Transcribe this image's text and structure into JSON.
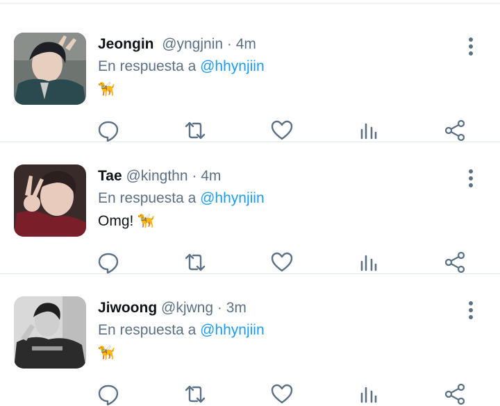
{
  "theme": {
    "text": "#0f1419",
    "secondary": "#5b7083",
    "link": "#1d9bf0",
    "divider": "#e1e8ed"
  },
  "tweets": [
    {
      "name": "Jeongin",
      "handle": "@yngjnin",
      "separator": "·",
      "time": "4m",
      "reply_prefix": "En respuesta a",
      "reply_to": "@hhynjiin",
      "text": "",
      "emoji": "🦮",
      "avatar_icon": "profile-photo"
    },
    {
      "name": "Tae",
      "handle": "@kingthn",
      "separator": "·",
      "time": "4m",
      "reply_prefix": "En respuesta a",
      "reply_to": "@hhynjiin",
      "text": "Omg!",
      "emoji": "🦮",
      "avatar_icon": "profile-photo"
    },
    {
      "name": "Jiwoong",
      "handle": "@kjwng",
      "separator": "·",
      "time": "3m",
      "reply_prefix": "En respuesta a",
      "reply_to": "@hhynjiin",
      "text": "",
      "emoji": "🦮",
      "avatar_icon": "profile-photo"
    }
  ],
  "action_icons": [
    "reply-icon",
    "retweet-icon",
    "like-icon",
    "analytics-icon",
    "share-icon"
  ]
}
